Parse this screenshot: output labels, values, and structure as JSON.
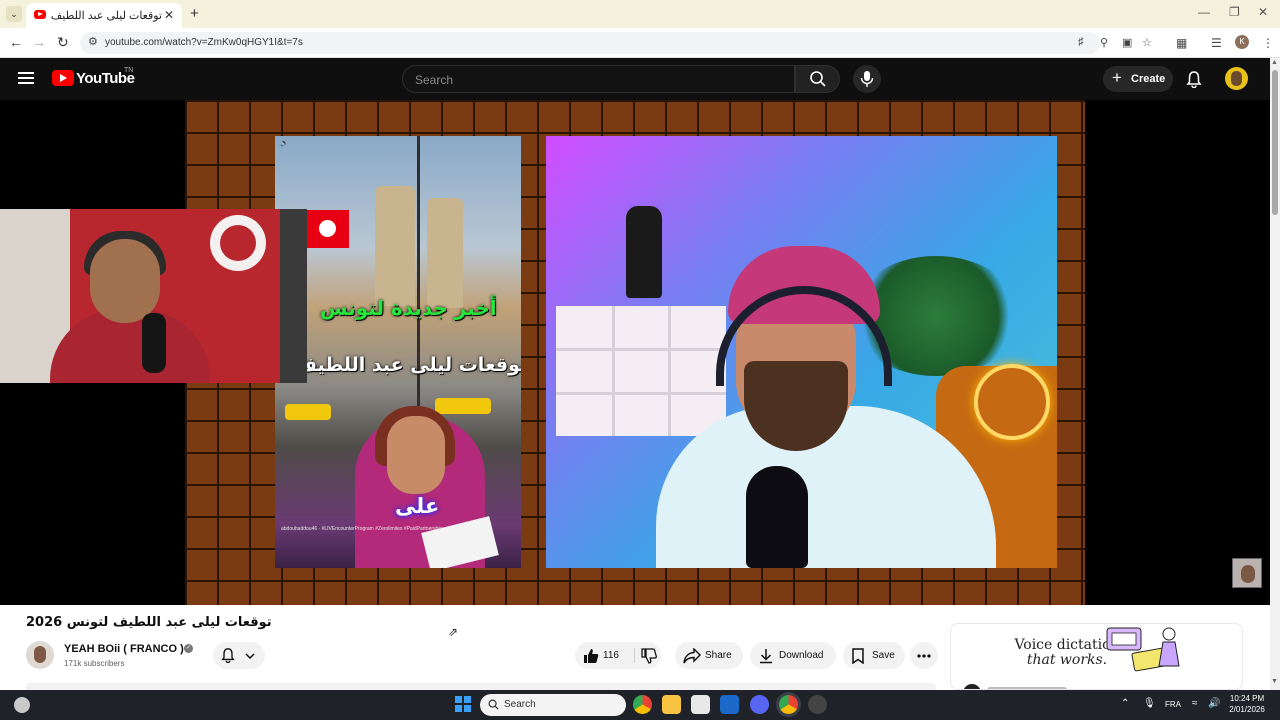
{
  "browser": {
    "tab_title": "توقعات ليلى عبد اللطيف لتو",
    "url": "youtube.com/watch?v=ZmKw0qHGY1I&t=7s",
    "profile_initial": "K"
  },
  "youtube": {
    "logo_text": "YouTube",
    "logo_country": "TN",
    "search_placeholder": "Search",
    "create_label": "Create"
  },
  "player": {
    "clip_caption_top": "أخبر جديدة لتونس",
    "clip_caption_mid": "توقعات ليلى عبد اللطيف",
    "clip_caption_bottom": "على",
    "clip_credit": "abdouhaddou46 · #LIVEncounterProgram #Zerolimites #PaidPartnership"
  },
  "video": {
    "title": "توقعات ليلى عبد اللطيف لتونس 2026",
    "channel_name": "YEAH BOii ( FRANCO )",
    "subscribers": "171k subscribers",
    "likes": "116",
    "share_label": "Share",
    "download_label": "Download",
    "save_label": "Save"
  },
  "ad": {
    "text_line1": "Voice dictation",
    "text_line2": "that works."
  },
  "taskbar": {
    "search_label": "Search",
    "language": "FRA",
    "time": "10:24 PM",
    "date": "2/01/2026"
  },
  "colors": {
    "youtube_red": "#ff0000",
    "header_bg": "#0f0f0f",
    "frame_brown": "#7a3b12",
    "taskbar_bg": "#1f2228"
  }
}
